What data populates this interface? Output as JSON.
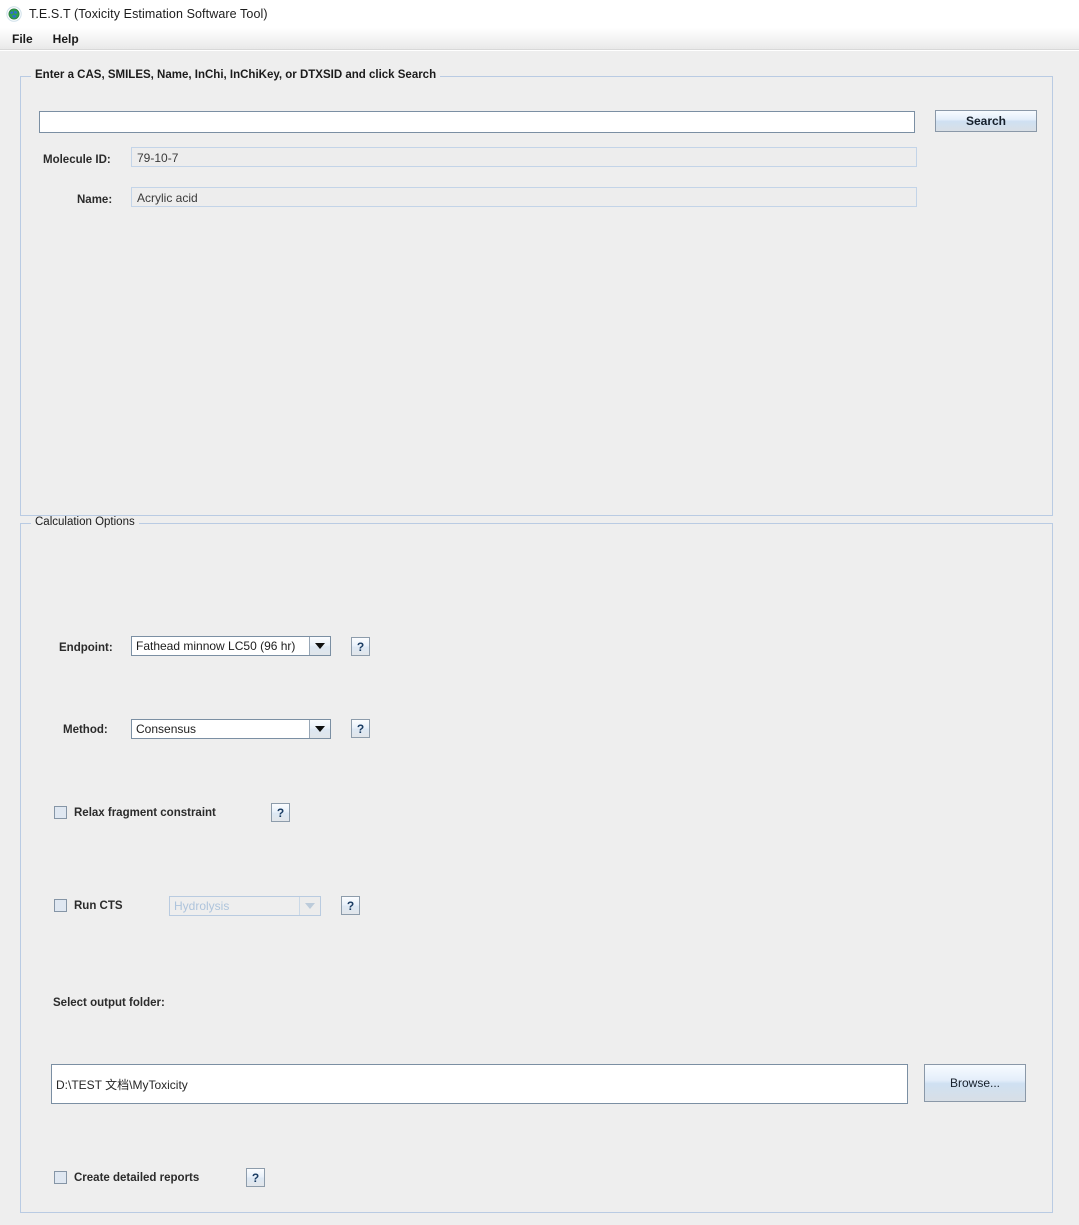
{
  "window": {
    "title": "T.E.S.T (Toxicity Estimation Software Tool)",
    "icon": "globe-icon"
  },
  "menubar": {
    "items": [
      {
        "label": "File"
      },
      {
        "label": "Help"
      }
    ]
  },
  "search_panel": {
    "title": "Enter a CAS, SMILES, Name, InChi, InChiKey, or DTXSID and click Search",
    "query_input": {
      "value": "",
      "placeholder": ""
    },
    "search_button": {
      "label": "Search"
    },
    "molecule_id": {
      "label": "Molecule ID:",
      "value": "79-10-7"
    },
    "name": {
      "label": "Name:",
      "value": "Acrylic acid"
    }
  },
  "calculation_panel": {
    "title": "Calculation Options",
    "endpoint": {
      "label": "Endpoint:",
      "value": "Fathead minnow LC50 (96 hr)",
      "help": "?"
    },
    "method": {
      "label": "Method:",
      "value": "Consensus",
      "help": "?"
    },
    "relax_fragment": {
      "label": "Relax fragment constraint",
      "checked": false,
      "help": "?"
    },
    "run_cts": {
      "label": "Run CTS",
      "checked": false,
      "process_value": "Hydrolysis",
      "process_enabled": false,
      "help": "?"
    },
    "output_folder": {
      "label": "Select output folder:",
      "value": "D:\\TEST 文档\\MyToxicity",
      "browse_button": "Browse..."
    },
    "detailed_reports": {
      "label": "Create detailed reports",
      "checked": false,
      "help": "?"
    }
  },
  "colors": {
    "panel_bg": "#eeeeee",
    "panel_border": "#b9cbe3",
    "field_border": "#7b8fa3",
    "button_accent": "#cfe0f2"
  }
}
